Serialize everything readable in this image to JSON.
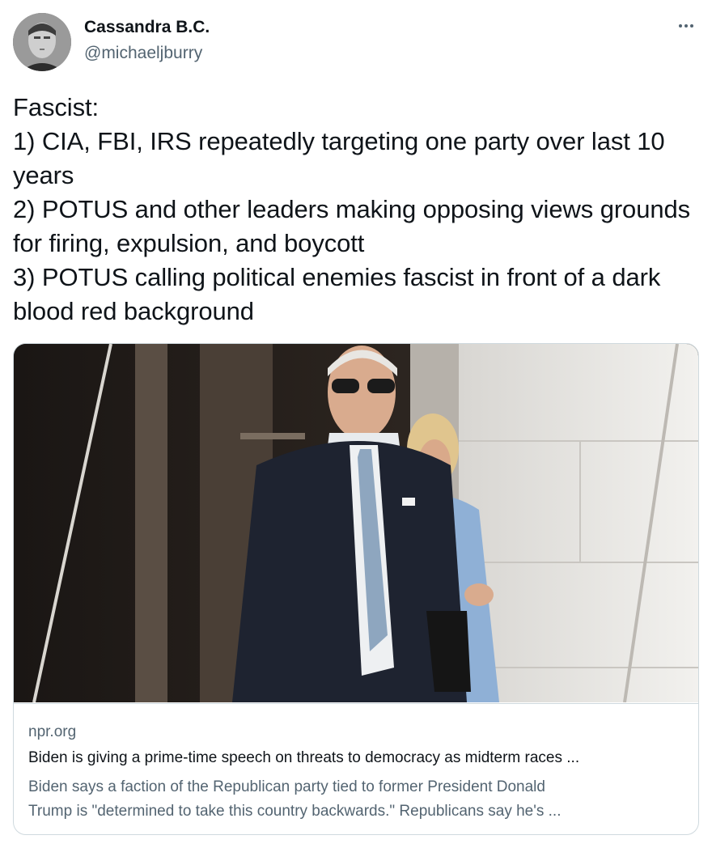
{
  "author": {
    "name": "Cassandra B.C.",
    "handle": "@michaeljburry",
    "avatar_icon": "profile-photo"
  },
  "menu": {
    "icon": "more-horizontal-icon"
  },
  "tweet": {
    "text": "Fascist:\n1) CIA, FBI, IRS repeatedly targeting one party over last 10 years\n2) POTUS and other leaders making opposing views grounds for firing, expulsion, and boycott\n3) POTUS calling political enemies fascist in front of a dark blood red background"
  },
  "link_card": {
    "image_icon": "news-photo",
    "domain": "npr.org",
    "title": "Biden is giving a prime-time speech on threats to democracy as midterm races ...",
    "description": "Biden says a faction of the Republican party tied to former President Donald\nTrump is \"determined to take this country backwards.\" Republicans say he's ..."
  },
  "colors": {
    "text_primary": "#0f1419",
    "text_secondary": "#536471",
    "border": "#cfd9de",
    "background": "#ffffff"
  }
}
